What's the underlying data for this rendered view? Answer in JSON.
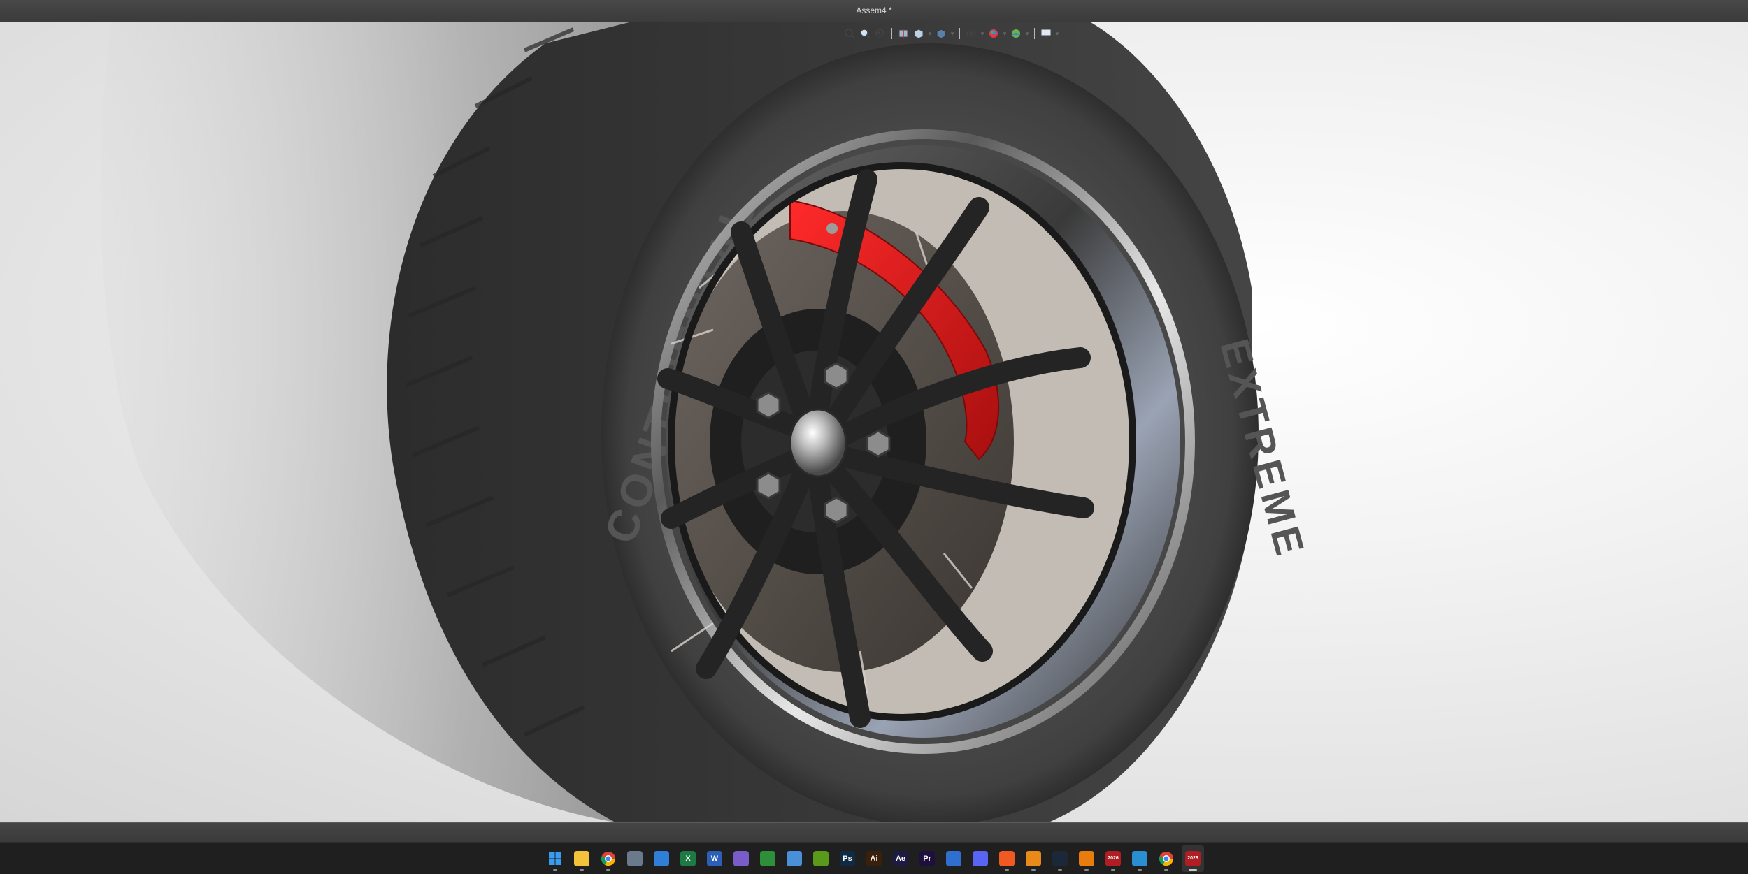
{
  "window": {
    "title": "Assem4 *"
  },
  "viewport": {
    "tire_brand_text": "CONTINENTAL",
    "tire_model_text": "EXTREME",
    "caliper_color": "#d21818",
    "rim_color": "#2a2a2a",
    "tire_color": "#3c3c3c"
  },
  "heads_up_toolbar": {
    "tools": [
      "zoom-to-fit-icon",
      "zoom-to-area-icon",
      "previous-view-icon",
      "section-view-icon",
      "view-orientation-icon",
      "display-style-icon",
      "hide-show-items-icon",
      "edit-appearance-icon",
      "apply-scene-icon",
      "view-settings-icon"
    ]
  },
  "taskbar": {
    "apps": [
      {
        "name": "Start",
        "label": "",
        "color": "#2b8be6"
      },
      {
        "name": "File Explorer",
        "label": "",
        "color": "#f3c13a"
      },
      {
        "name": "Google Chrome",
        "label": "",
        "color": "#4285f4"
      },
      {
        "name": "Calculator",
        "label": "",
        "color": "#6a7a8c"
      },
      {
        "name": "Microsoft Store",
        "label": "",
        "color": "#2f7fd8"
      },
      {
        "name": "Excel",
        "label": "X",
        "color": "#1d7a45"
      },
      {
        "name": "Word",
        "label": "W",
        "color": "#2b5fb8"
      },
      {
        "name": "Camera",
        "label": "",
        "color": "#7a5cc8"
      },
      {
        "name": "Xbox",
        "label": "",
        "color": "#2d8f3a"
      },
      {
        "name": "Notepad",
        "label": "",
        "color": "#4a90d9"
      },
      {
        "name": "NVIDIA",
        "label": "",
        "color": "#5a9a1a"
      },
      {
        "name": "Photoshop",
        "label": "Ps",
        "color": "#0f2a44"
      },
      {
        "name": "Illustrator",
        "label": "Ai",
        "color": "#3a1f0a"
      },
      {
        "name": "After Effects",
        "label": "Ae",
        "color": "#1d1a44"
      },
      {
        "name": "Premiere Pro",
        "label": "Pr",
        "color": "#1f0f3d"
      },
      {
        "name": "Thunderbird",
        "label": "",
        "color": "#2f6fd0"
      },
      {
        "name": "Discord",
        "label": "",
        "color": "#5865f2"
      },
      {
        "name": "Origin",
        "label": "",
        "color": "#f05a22"
      },
      {
        "name": "FL Studio",
        "label": "",
        "color": "#e88a1a"
      },
      {
        "name": "Steam",
        "label": "",
        "color": "#1b2838"
      },
      {
        "name": "Blender",
        "label": "",
        "color": "#e87d0d"
      },
      {
        "name": "SOLIDWORKS 2026",
        "label": "2026",
        "color": "#b01e23"
      },
      {
        "name": "3D App",
        "label": "",
        "color": "#2a8fd0"
      },
      {
        "name": "Google Chrome Profile",
        "label": "",
        "color": "#db4437"
      },
      {
        "name": "SOLIDWORKS 2026 Active",
        "label": "2026",
        "color": "#b01e23"
      }
    ]
  }
}
